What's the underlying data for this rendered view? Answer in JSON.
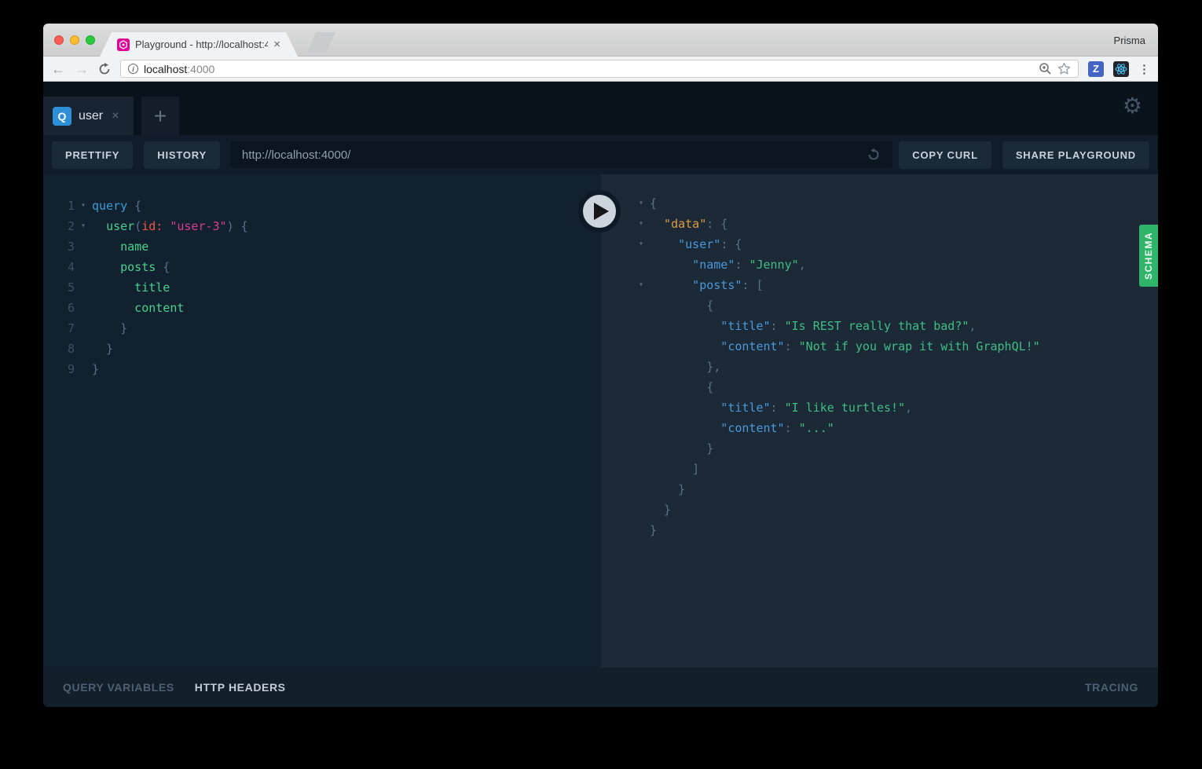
{
  "browser": {
    "tab_title": "Playground - http://localhost:4",
    "tab_close": "×",
    "profile_name": "Prisma",
    "url": {
      "host": "localhost",
      "port": ":4000"
    },
    "extensions": {
      "z_label": "Z"
    },
    "menu_dots": "⋮"
  },
  "playground": {
    "session_tab": {
      "badge": "Q",
      "title": "user",
      "close": "×"
    },
    "new_tab_label": "+",
    "settings_icon": "⚙",
    "toolbar": {
      "prettify_label": "PRETTIFY",
      "history_label": "HISTORY",
      "endpoint_url": "http://localhost:4000/",
      "copy_curl_label": "COPY CURL",
      "share_label": "SHARE PLAYGROUND"
    },
    "schema_tab_label": "SCHEMA",
    "footer": {
      "query_variables_label": "QUERY VARIABLES",
      "http_headers_label": "HTTP HEADERS",
      "tracing_label": "TRACING"
    },
    "query_editor": {
      "lines": [
        {
          "num": "1",
          "fold": true,
          "tokens": [
            [
              "kw",
              "query"
            ],
            [
              "pun",
              " {"
            ]
          ]
        },
        {
          "num": "2",
          "fold": true,
          "tokens": [
            [
              "pun",
              "  "
            ],
            [
              "field",
              "user"
            ],
            [
              "pun",
              "("
            ],
            [
              "arg",
              "id:"
            ],
            [
              "pun",
              " "
            ],
            [
              "pstr",
              "\"user-3\""
            ],
            [
              "pun",
              ") {"
            ]
          ]
        },
        {
          "num": "3",
          "fold": false,
          "tokens": [
            [
              "field",
              "    name"
            ]
          ]
        },
        {
          "num": "4",
          "fold": false,
          "tokens": [
            [
              "field",
              "    posts"
            ],
            [
              "pun",
              " {"
            ]
          ]
        },
        {
          "num": "5",
          "fold": false,
          "tokens": [
            [
              "field",
              "      title"
            ]
          ]
        },
        {
          "num": "6",
          "fold": false,
          "tokens": [
            [
              "field",
              "      content"
            ]
          ]
        },
        {
          "num": "7",
          "fold": false,
          "tokens": [
            [
              "pun",
              "    }"
            ]
          ]
        },
        {
          "num": "8",
          "fold": false,
          "tokens": [
            [
              "pun",
              "  }"
            ]
          ]
        },
        {
          "num": "9",
          "fold": false,
          "tokens": [
            [
              "pun",
              "}"
            ]
          ]
        }
      ]
    },
    "response_viewer": {
      "lines": [
        {
          "fold": true,
          "tokens": [
            [
              "pun",
              "{"
            ]
          ]
        },
        {
          "fold": true,
          "tokens": [
            [
              "key2",
              "  \"data\""
            ],
            [
              "pun",
              ": {"
            ]
          ]
        },
        {
          "fold": true,
          "tokens": [
            [
              "key",
              "    \"user\""
            ],
            [
              "pun",
              ": {"
            ]
          ]
        },
        {
          "fold": false,
          "tokens": [
            [
              "key",
              "      \"name\""
            ],
            [
              "pun",
              ": "
            ],
            [
              "str",
              "\"Jenny\""
            ],
            [
              "pun",
              ","
            ]
          ]
        },
        {
          "fold": true,
          "tokens": [
            [
              "key",
              "      \"posts\""
            ],
            [
              "pun",
              ": ["
            ]
          ]
        },
        {
          "fold": false,
          "tokens": [
            [
              "pun",
              "        {"
            ]
          ]
        },
        {
          "fold": false,
          "tokens": [
            [
              "key",
              "          \"title\""
            ],
            [
              "pun",
              ": "
            ],
            [
              "str",
              "\"Is REST really that bad?\""
            ],
            [
              "pun",
              ","
            ]
          ]
        },
        {
          "fold": false,
          "tokens": [
            [
              "key",
              "          \"content\""
            ],
            [
              "pun",
              ": "
            ],
            [
              "str",
              "\"Not if you wrap it with GraphQL!\""
            ]
          ]
        },
        {
          "fold": false,
          "tokens": [
            [
              "pun",
              "        },"
            ]
          ]
        },
        {
          "fold": false,
          "tokens": [
            [
              "pun",
              "        {"
            ]
          ]
        },
        {
          "fold": false,
          "tokens": [
            [
              "key",
              "          \"title\""
            ],
            [
              "pun",
              ": "
            ],
            [
              "str",
              "\"I like turtles!\""
            ],
            [
              "pun",
              ","
            ]
          ]
        },
        {
          "fold": false,
          "tokens": [
            [
              "key",
              "          \"content\""
            ],
            [
              "pun",
              ": "
            ],
            [
              "str",
              "\"...\""
            ]
          ]
        },
        {
          "fold": false,
          "tokens": [
            [
              "pun",
              "        }"
            ]
          ]
        },
        {
          "fold": false,
          "tokens": [
            [
              "pun",
              "      ]"
            ]
          ]
        },
        {
          "fold": false,
          "tokens": [
            [
              "pun",
              "    }"
            ]
          ]
        },
        {
          "fold": false,
          "tokens": [
            [
              "pun",
              "  }"
            ]
          ]
        },
        {
          "fold": false,
          "tokens": [
            [
              "pun",
              "}"
            ]
          ]
        }
      ]
    }
  },
  "colors": {
    "brand_pink": "#e10098",
    "schema_green": "#2fb56a",
    "query_badge_blue": "#2d8fd8",
    "keyword_blue": "#3b9bd9",
    "field_green": "#4ad18c",
    "argument_red": "#eb5a44",
    "string_pink": "#d63d93",
    "json_key_blue": "#4a98d9",
    "json_data_orange": "#de9b3f",
    "json_string_green": "#3fbd84",
    "traffic_red": "#fc5f57",
    "traffic_yellow": "#febc2e",
    "traffic_green": "#2bc840"
  }
}
